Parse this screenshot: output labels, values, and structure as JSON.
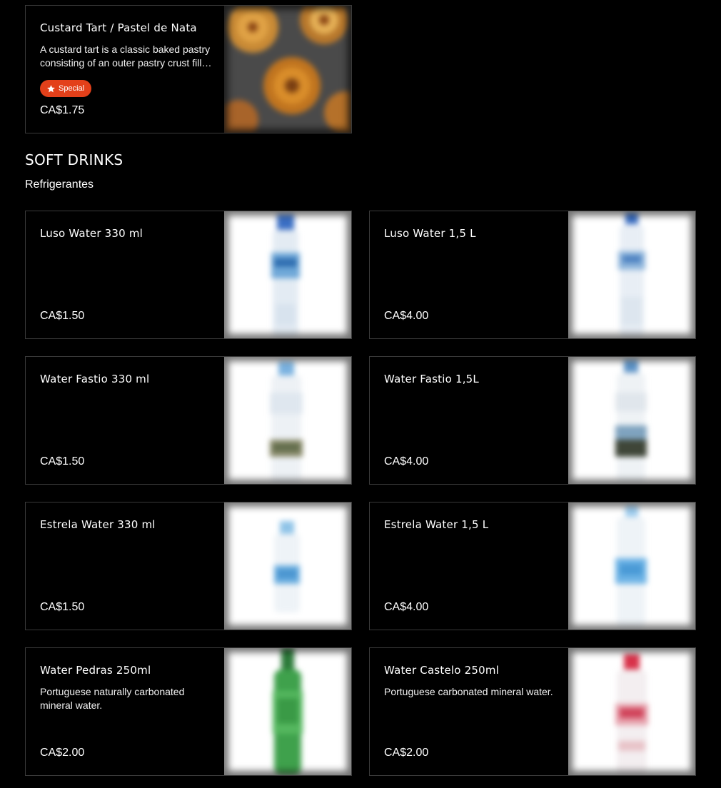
{
  "top_item": {
    "title": "Custard Tart / Pastel de Nata",
    "description": "A custard tart is a classic baked pastry consisting of an outer pastry crust filled with egg custard.",
    "badge": "Special",
    "price": "CA$1.75",
    "image_icon": "custard-tart-image"
  },
  "section": {
    "title": "SOFT DRINKS",
    "subtitle": "Refrigerantes"
  },
  "items": [
    {
      "title": "Luso Water 330 ml",
      "description": "",
      "price": "CA$1.50"
    },
    {
      "title": "Luso Water 1,5 L",
      "description": "",
      "price": "CA$4.00"
    },
    {
      "title": "Water Fastio 330 ml",
      "description": "",
      "price": "CA$1.50"
    },
    {
      "title": "Water Fastio 1,5L",
      "description": "",
      "price": "CA$4.00"
    },
    {
      "title": "Estrela Water 330 ml",
      "description": "",
      "price": "CA$1.50"
    },
    {
      "title": "Estrela Water 1,5 L",
      "description": "",
      "price": "CA$4.00"
    },
    {
      "title": "Water Pedras 250ml",
      "description": "Portuguese naturally carbonated mineral water.",
      "price": "CA$2.00"
    },
    {
      "title": "Water Castelo 250ml",
      "description": "Portuguese carbonated mineral water.",
      "price": "CA$2.00"
    }
  ],
  "colors": {
    "badge_bg": "#e3401a",
    "card_border": "#3a3a3a",
    "background": "#000000"
  }
}
